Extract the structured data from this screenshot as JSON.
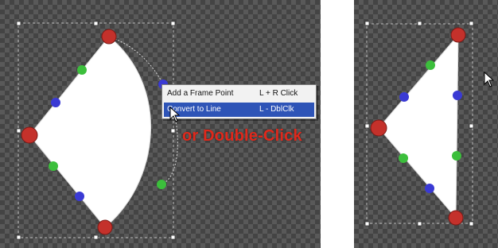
{
  "context_menu": {
    "items": [
      {
        "label": "Add a Frame Point",
        "shortcut": "L + R Click"
      },
      {
        "label": "Convert to Line",
        "shortcut": "L - DblClk"
      }
    ]
  },
  "caption": {
    "text": "or Double-Click"
  },
  "colors": {
    "corner_point": "#c4312b",
    "green_point": "#3cbf3c",
    "blue_point": "#3a3ad4",
    "shape_fill": "#ffffff",
    "selected_menu": "#2e54b7",
    "caption": "#e0281b"
  },
  "icons": [
    "mouse-cursor-icon"
  ]
}
